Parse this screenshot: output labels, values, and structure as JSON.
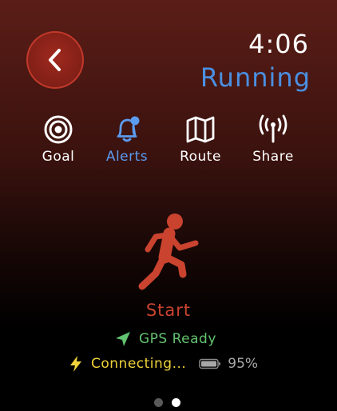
{
  "status_bar": {
    "time": "4:06"
  },
  "header": {
    "title": "Running",
    "back_icon": "chevron-left-icon"
  },
  "toolbar": {
    "items": [
      {
        "label": "Goal",
        "icon": "target-icon",
        "active": false
      },
      {
        "label": "Alerts",
        "icon": "bell-icon",
        "active": true
      },
      {
        "label": "Route",
        "icon": "map-icon",
        "active": false
      },
      {
        "label": "Share",
        "icon": "broadcast-icon",
        "active": false
      }
    ]
  },
  "main": {
    "start_label": "Start",
    "runner_icon": "runner-icon",
    "gps_status": "GPS Ready",
    "connection_status": "Connecting...",
    "battery_level": "95%",
    "battery_fraction": 0.95
  },
  "pager": {
    "count": 2,
    "active_index": 1
  },
  "colors": {
    "accent_blue": "#4a90e2",
    "start_red": "#c9432f",
    "gps_green": "#62c370",
    "connect_yellow": "#f0d33a"
  }
}
